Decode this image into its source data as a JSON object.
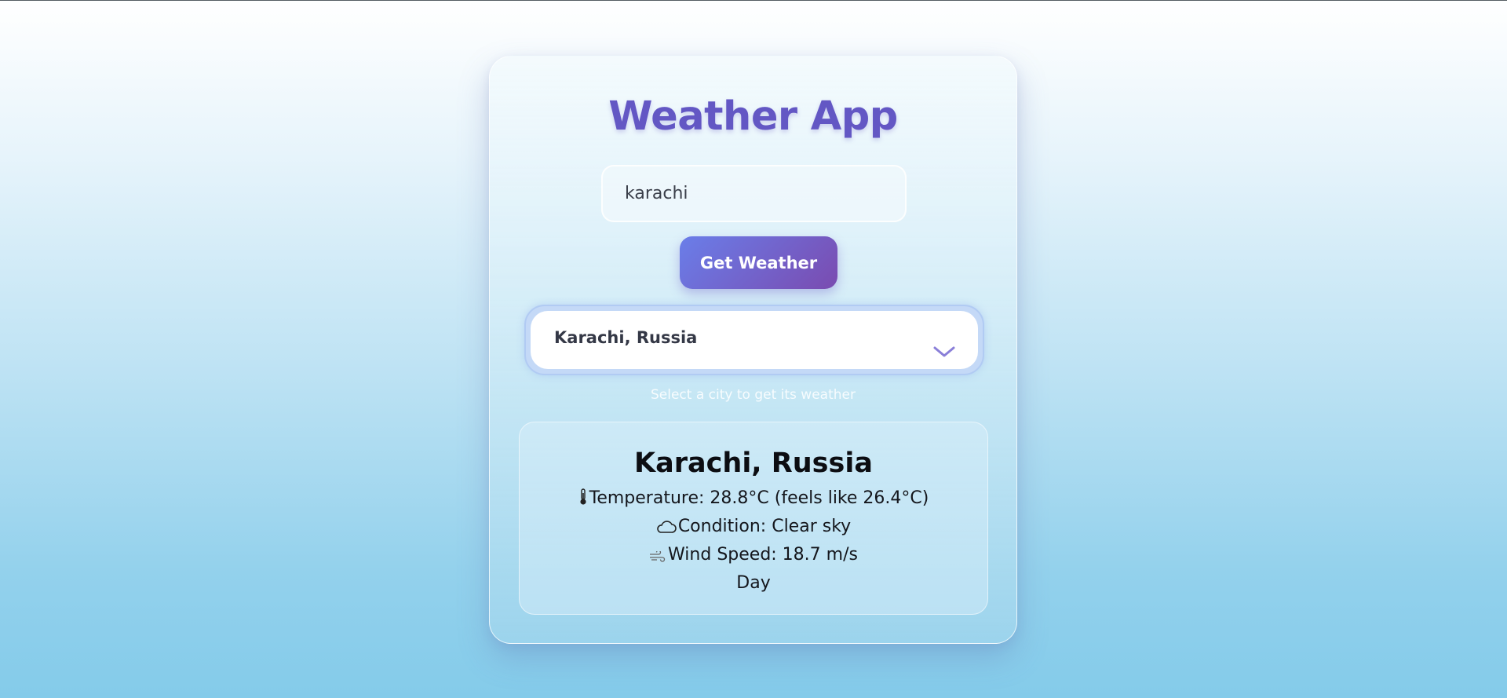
{
  "app": {
    "title": "Weather App"
  },
  "search": {
    "value": "karachi",
    "button_label": "Get Weather"
  },
  "city_select": {
    "selected": "Karachi, Russia",
    "hint": "Select a city to get its weather"
  },
  "result": {
    "city": "Karachi, Russia",
    "temperature": "Temperature: 28.8°C (feels like 26.4°C)",
    "condition": "Condition: Clear sky",
    "wind": "Wind Speed: 18.7 m/s",
    "daypart": "Day",
    "icons": {
      "temperature": "thermometer-icon",
      "condition": "cloud-icon",
      "wind": "wind-icon"
    }
  },
  "colors": {
    "title": "#6357c4",
    "button_start": "#6a7ee9",
    "button_end": "#7a4bb0",
    "chevron": "#8a7fd8"
  }
}
